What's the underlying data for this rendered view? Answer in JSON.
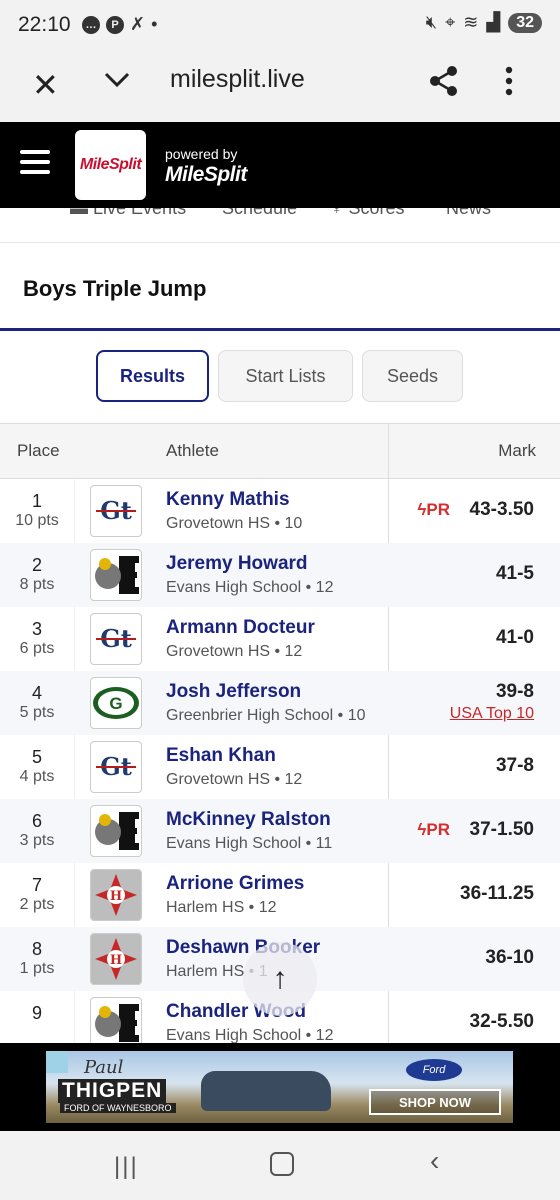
{
  "status_bar": {
    "time": "22:10",
    "battery": "32",
    "icons": [
      "chat-icon",
      "pinterest-icon",
      "app-icon",
      "dot-icon",
      "mute-icon",
      "location-icon",
      "wifi-icon",
      "signal-icon"
    ]
  },
  "browser": {
    "url": "milesplit.live",
    "icons": [
      "close-icon",
      "chevron-down-icon",
      "share-icon",
      "more-icon"
    ]
  },
  "site_header": {
    "logo_text": "MileSplit",
    "powered_by": "powered by",
    "powered_brand": "MileSplit"
  },
  "subnav": {
    "items": [
      "Live Events",
      "Schedule",
      "Scores",
      "News"
    ]
  },
  "event": {
    "title": "Boys Triple Jump"
  },
  "tabs": [
    {
      "label": "Results",
      "active": true
    },
    {
      "label": "Start Lists",
      "active": false
    },
    {
      "label": "Seeds",
      "active": false
    }
  ],
  "table": {
    "headers": {
      "place": "Place",
      "athlete": "Athlete",
      "mark": "Mark"
    },
    "rows": [
      {
        "place": "1",
        "pts": "10 pts",
        "name": "Kenny Mathis",
        "school": "Grovetown HS • 10",
        "mark": "43-3.50",
        "pr": "PR",
        "logo": "gt"
      },
      {
        "place": "2",
        "pts": "8 pts",
        "name": "Jeremy Howard",
        "school": "Evans High School • 12",
        "mark": "41-5",
        "logo": "e"
      },
      {
        "place": "3",
        "pts": "6 pts",
        "name": "Armann Docteur",
        "school": "Grovetown HS • 12",
        "mark": "41-0",
        "logo": "gt"
      },
      {
        "place": "4",
        "pts": "5 pts",
        "name": "Josh Jefferson",
        "school": "Greenbrier High School • 10",
        "mark": "39-8",
        "extra": "USA Top 10",
        "logo": "g"
      },
      {
        "place": "5",
        "pts": "4 pts",
        "name": "Eshan Khan",
        "school": "Grovetown HS • 12",
        "mark": "37-8",
        "logo": "gt"
      },
      {
        "place": "6",
        "pts": "3 pts",
        "name": "McKinney Ralston",
        "school": "Evans High School • 11",
        "mark": "37-1.50",
        "pr": "PR",
        "logo": "e"
      },
      {
        "place": "7",
        "pts": "2 pts",
        "name": "Arrione Grimes",
        "school": "Harlem HS • 12",
        "mark": "36-11.25",
        "logo": "h"
      },
      {
        "place": "8",
        "pts": "1 pts",
        "name": "Deshawn Booker",
        "school": "Harlem HS • 1",
        "mark": "36-10",
        "logo": "h"
      },
      {
        "place": "9",
        "pts": "",
        "name": "Chandler Wood",
        "school": "Evans High School • 12",
        "mark": "32-5.50",
        "logo": "e"
      }
    ]
  },
  "ad": {
    "name_script": "Paul",
    "name_main": "THIGPEN",
    "tagline": "FORD OF WAYNESBORO",
    "brand": "Ford",
    "cta": "SHOP NOW"
  },
  "colors": {
    "navy": "#1a237e",
    "pr_red": "#d32f2f",
    "header_black": "#000000"
  }
}
